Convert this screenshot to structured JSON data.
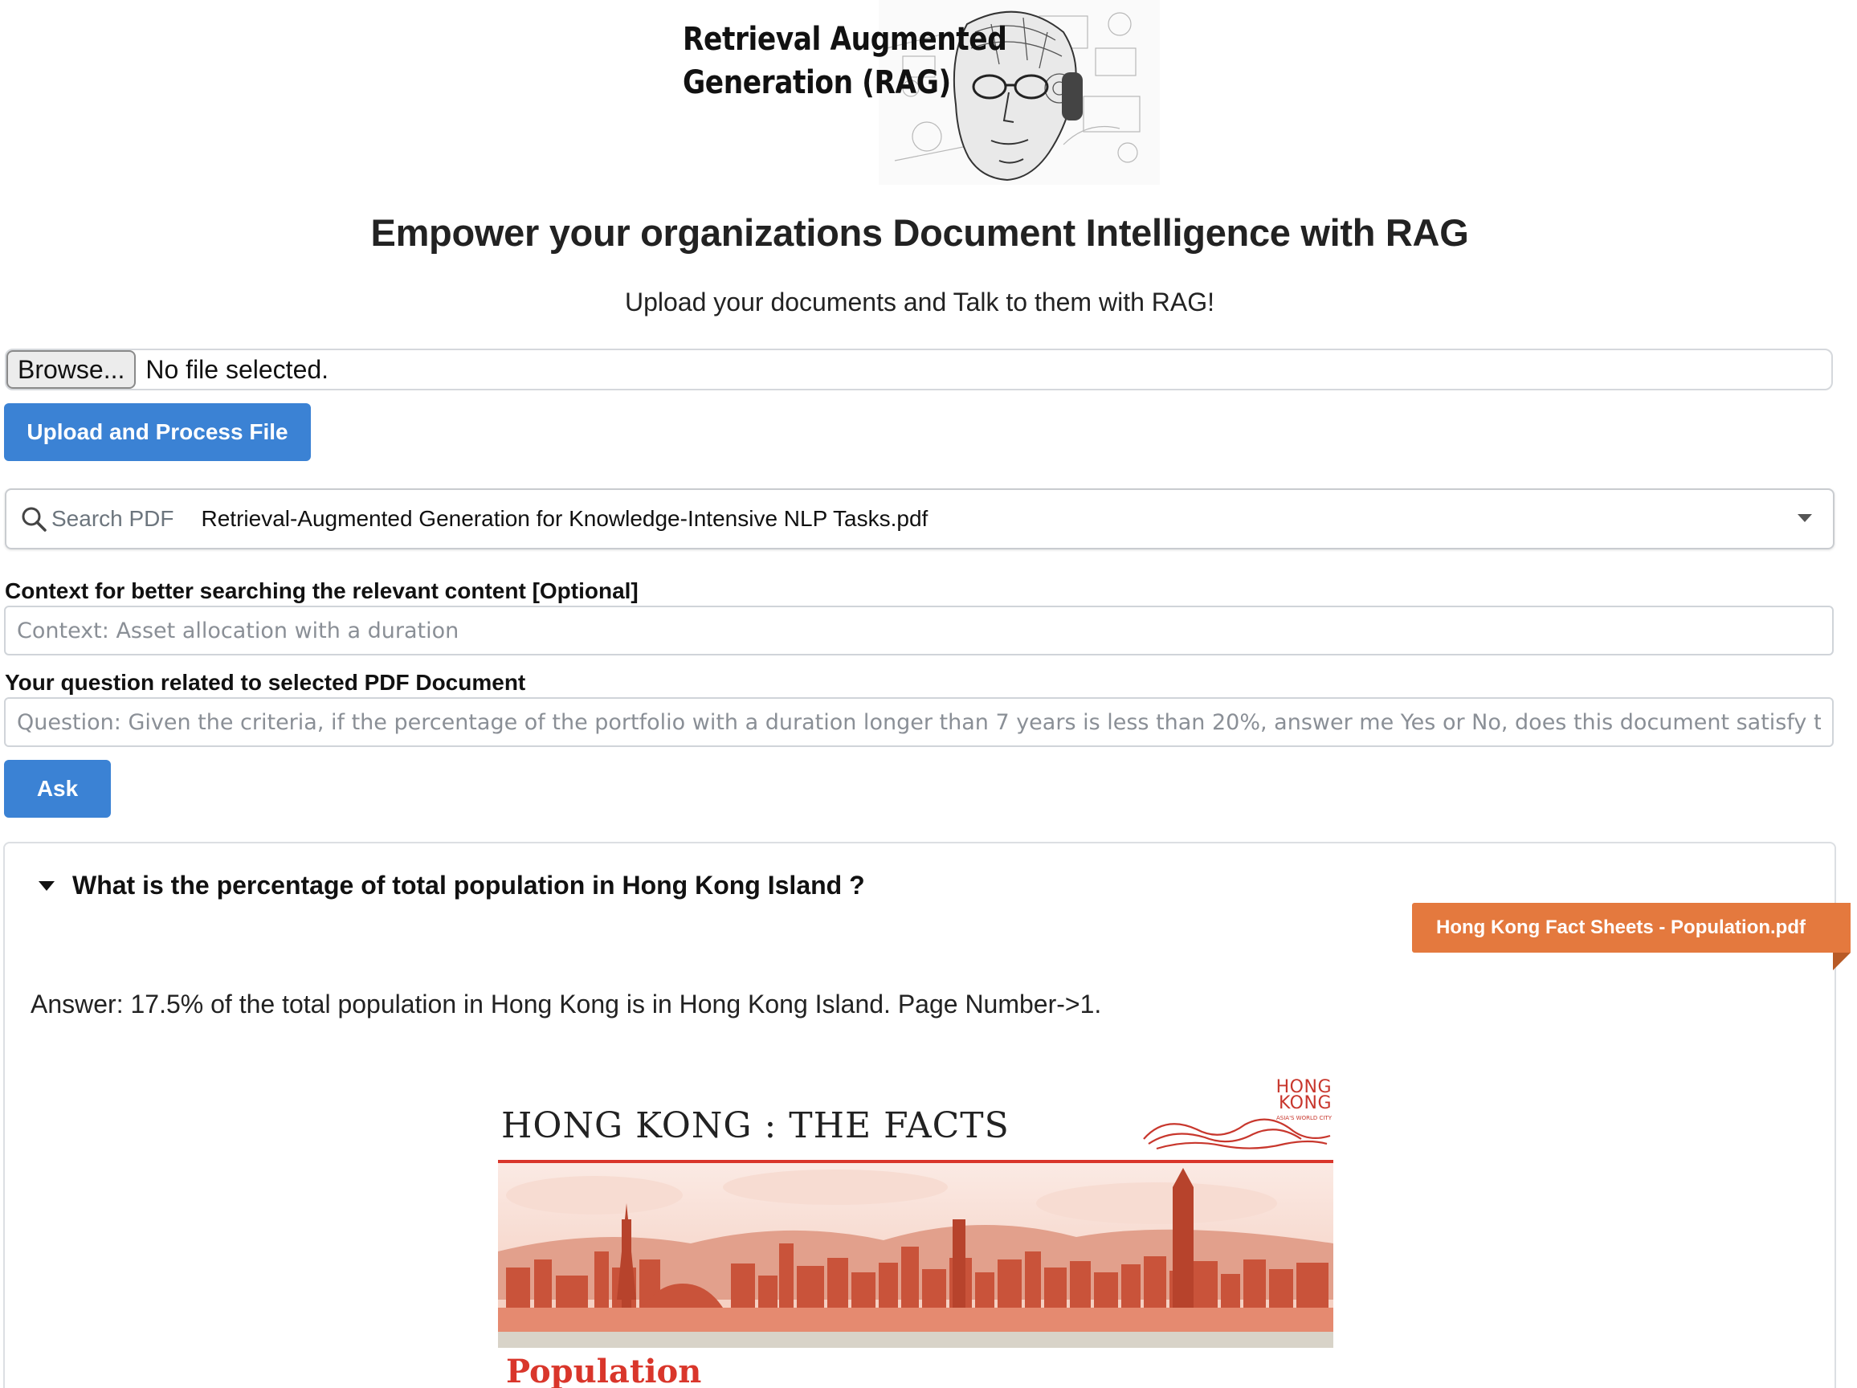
{
  "logo": {
    "line1": "Retrieval Augmented",
    "line2": "Generation (RAG)",
    "art_icon": "robot-face-sketch-icon"
  },
  "header": {
    "title": "Empower your organizations Document Intelligence with RAG",
    "subtitle": "Upload your documents and Talk to them with RAG!"
  },
  "file_upload": {
    "browse_label": "Browse...",
    "status": "No file selected.",
    "upload_button": "Upload and Process File"
  },
  "pdf_select": {
    "placeholder": "Search PDF",
    "selected": "Retrieval-Augmented Generation for Knowledge-Intensive NLP Tasks.pdf",
    "icon": "search-icon"
  },
  "context": {
    "label": "Context for better searching the relevant content [Optional]",
    "placeholder": "Context: Asset allocation with a duration"
  },
  "question": {
    "label": "Your question related to selected PDF Document",
    "placeholder": "Question: Given the criteria, if the percentage of the portfolio with a duration longer than 7 years is less than 20%, answer me Yes or No, does this document satisfy this criteria?",
    "ask_button": "Ask"
  },
  "result": {
    "question": "What is the percentage of total population in Hong Kong Island ?",
    "source": "Hong Kong Fact Sheets - Population.pdf",
    "answer": "Answer: 17.5% of the total population in Hong Kong is in Hong Kong Island. Page Number->1.",
    "preview": {
      "title": "HONG KONG : THE FACTS",
      "logo_line1": "HONG",
      "logo_line2": "KONG",
      "logo_sub": "ASIA'S WORLD CITY",
      "section": "Population"
    }
  },
  "colors": {
    "primary": "#3b82d4",
    "ribbon": "#e4793e",
    "hk_red": "#d9362b"
  }
}
